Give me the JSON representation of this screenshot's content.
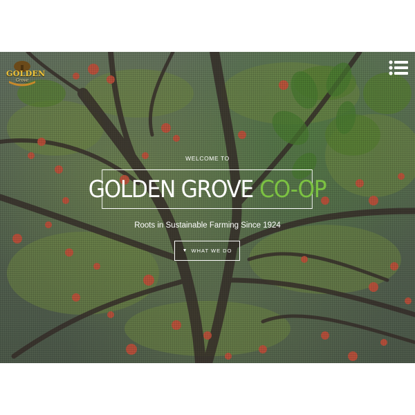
{
  "brand": {
    "logo_text": "GOLDEN",
    "logo_sub": "Grove"
  },
  "nav": {
    "menu_icon": "hamburger-list-icon"
  },
  "hero": {
    "welcome": "WELCOME TO",
    "title_main": "GOLDEN GROVE",
    "title_accent": "CO-OP",
    "tagline": "Roots in Sustainable Farming Since 1924",
    "cta_icon": "chevron-down-icon",
    "cta_label": "WHAT WE DO"
  },
  "colors": {
    "accent_green": "#7cc242",
    "logo_gold": "#f0c43c",
    "text": "#ffffff"
  }
}
